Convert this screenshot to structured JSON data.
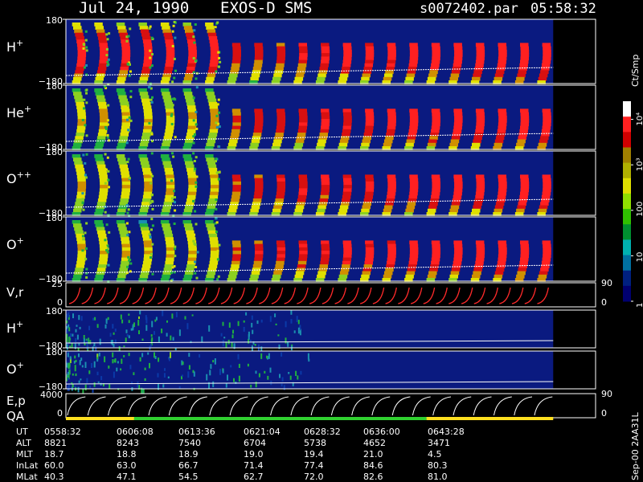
{
  "header": {
    "date": "Jul 24, 1990",
    "mission": "EXOS-D SMS",
    "file": "s0072402.par",
    "time": "05:58:32"
  },
  "colors": {
    "background": "#000000",
    "field": "#0a1a80",
    "panel_border": "#ffffff",
    "velocity_trace": "#ff2a2a",
    "qa_yellow": "#ffe020",
    "qa_green": "#30d030"
  },
  "colorbar": {
    "unit": "Ct/Smp",
    "tick_labels": [
      "10⁴",
      "10³",
      "100",
      "10",
      "1"
    ],
    "tick_values": [
      10000,
      1000,
      100,
      10,
      1
    ],
    "colors": [
      "#ffffff",
      "#ff2020",
      "#d00000",
      "#a08000",
      "#b0b000",
      "#e0e000",
      "#90e000",
      "#30c000",
      "#009030",
      "#00b0b0",
      "#0070a0",
      "#002080",
      "#000070"
    ]
  },
  "side_note": "Sep-00 2AA31L",
  "chart_data": {
    "type": "heatmap",
    "x_axis": {
      "tick_labels": [
        "0558:32",
        "0606:08",
        "0613:36",
        "0621:04",
        "0628:32",
        "0636:00",
        "0643:28"
      ],
      "data_end_fraction": 0.92
    },
    "panels": [
      {
        "id": "h-plus",
        "label": "H",
        "superscript": "+",
        "ymax": "180",
        "ymin": "−180",
        "pattern": "strong_early_then_bursts",
        "spin_periods": 22
      },
      {
        "id": "he-plus",
        "label": "He",
        "superscript": "+",
        "ymax": "180",
        "ymin": "−180",
        "pattern": "medium_early_then_bursts",
        "spin_periods": 22
      },
      {
        "id": "o-plus-plus",
        "label": "O",
        "superscript": "++",
        "ymax": "180",
        "ymin": "−180",
        "pattern": "medium_early_then_bursts",
        "spin_periods": 22
      },
      {
        "id": "o-plus",
        "label": "O",
        "superscript": "+",
        "ymax": "180",
        "ymin": "−180",
        "pattern": "medium_early_then_bursts",
        "spin_periods": 22
      }
    ],
    "velocity_panel": {
      "label": "V,r",
      "left_ticks": [
        "25",
        "0"
      ],
      "right_ticks": [
        "90",
        "0"
      ],
      "spikes": 38
    },
    "low_panels": [
      {
        "id": "h-plus-2",
        "label": "H",
        "superscript": "+",
        "ymax": "180",
        "ymin": "−180"
      },
      {
        "id": "o-plus-2",
        "label": "O",
        "superscript": "+",
        "ymax": "180",
        "ymin": "−180"
      }
    ],
    "ep_panel": {
      "label": "E,p",
      "label2": "QA",
      "left_ticks": [
        "4000",
        "0"
      ],
      "right_ticks": [
        "90",
        "0"
      ],
      "sweeps": 24
    }
  },
  "info_table": {
    "rows": [
      {
        "label": "UT",
        "values": [
          "0558:32",
          "0606:08",
          "0613:36",
          "0621:04",
          "0628:32",
          "0636:00",
          "0643:28"
        ]
      },
      {
        "label": "ALT",
        "values": [
          "8821",
          "8243",
          "7540",
          "6704",
          "5738",
          "4652",
          "3471"
        ]
      },
      {
        "label": "MLT",
        "values": [
          "18.7",
          "18.8",
          "18.9",
          "19.0",
          "19.4",
          "21.0",
          "4.5"
        ]
      },
      {
        "label": "InLat",
        "values": [
          "60.0",
          "63.0",
          "66.7",
          "71.4",
          "77.4",
          "84.6",
          "80.3"
        ]
      },
      {
        "label": "MLat",
        "values": [
          "40.3",
          "47.1",
          "54.5",
          "62.7",
          "72.0",
          "82.6",
          "81.0"
        ]
      }
    ]
  }
}
